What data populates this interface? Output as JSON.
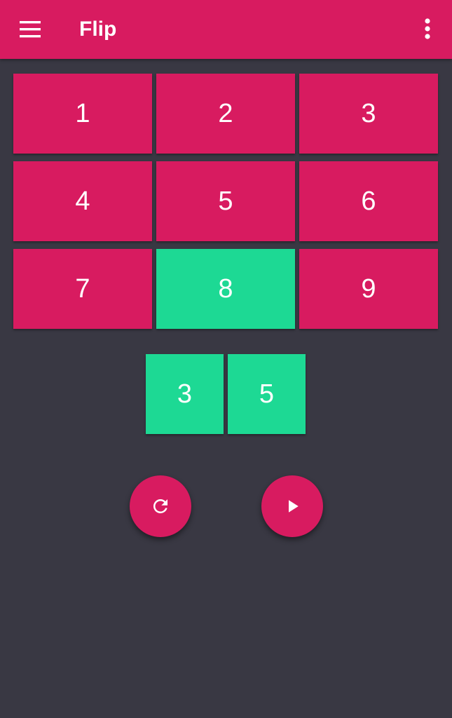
{
  "app_bar": {
    "title": "Flip",
    "menu_icon": "hamburger-menu-icon",
    "more_icon": "more-vert-icon",
    "color": "#d81b60"
  },
  "grid": {
    "tiles": [
      {
        "label": "1",
        "state": "off"
      },
      {
        "label": "2",
        "state": "off"
      },
      {
        "label": "3",
        "state": "off"
      },
      {
        "label": "4",
        "state": "off"
      },
      {
        "label": "5",
        "state": "off"
      },
      {
        "label": "6",
        "state": "off"
      },
      {
        "label": "7",
        "state": "off"
      },
      {
        "label": "8",
        "state": "on"
      },
      {
        "label": "9",
        "state": "off"
      }
    ],
    "off_color": "#d81b60",
    "on_color": "#1dd994"
  },
  "dice": {
    "values": [
      "3",
      "5"
    ]
  },
  "actions": {
    "reset_icon": "refresh-icon",
    "play_icon": "play-icon"
  },
  "background_color": "#393843"
}
